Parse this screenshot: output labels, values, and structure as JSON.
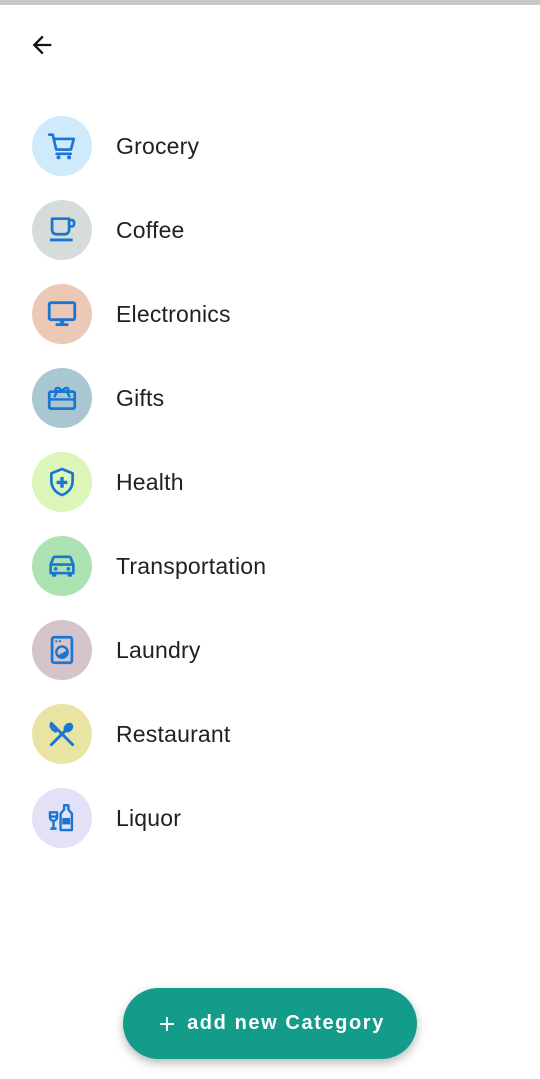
{
  "colors": {
    "icon": "#1976d2",
    "fab": "#139c8a",
    "text": "#212121"
  },
  "header": {
    "back_icon": "arrow-back-icon"
  },
  "categories": [
    {
      "label": "Grocery",
      "icon": "shopping-cart-icon",
      "bg": "#cfeafb"
    },
    {
      "label": "Coffee",
      "icon": "coffee-cup-icon",
      "bg": "#d5dcda"
    },
    {
      "label": "Electronics",
      "icon": "monitor-icon",
      "bg": "#ecc8b6"
    },
    {
      "label": "Gifts",
      "icon": "gift-card-icon",
      "bg": "#a9c7d1"
    },
    {
      "label": "Health",
      "icon": "health-shield-icon",
      "bg": "#dbf6b8"
    },
    {
      "label": "Transportation",
      "icon": "car-icon",
      "bg": "#ade2b2"
    },
    {
      "label": "Laundry",
      "icon": "washing-machine-icon",
      "bg": "#d5c4cb"
    },
    {
      "label": "Restaurant",
      "icon": "fork-spoon-icon",
      "bg": "#e9e3a4"
    },
    {
      "label": "Liquor",
      "icon": "liquor-bottle-icon",
      "bg": "#e2e1f6"
    }
  ],
  "fab": {
    "label": "add new Category",
    "icon": "plus-icon"
  }
}
